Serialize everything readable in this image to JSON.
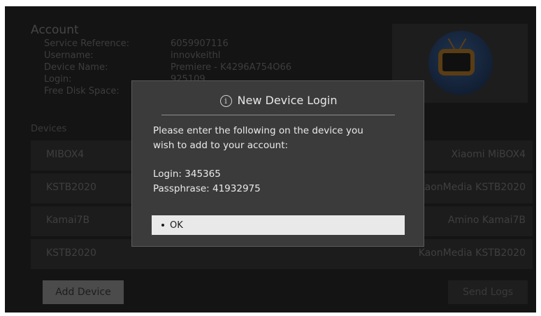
{
  "account": {
    "title": "Account",
    "rows": [
      {
        "label": "Service Reference:",
        "value": "6059907116"
      },
      {
        "label": "Username:",
        "value": "innovkeithl"
      },
      {
        "label": "Device Name:",
        "value": "Premiere - K4296A754O66"
      },
      {
        "label": "Login:",
        "value": "925109"
      },
      {
        "label": "Free Disk Space:",
        "value": ""
      }
    ]
  },
  "devices": {
    "label": "Devices",
    "items": [
      {
        "name": "MIBOX4",
        "model": "Xiaomi MiBOX4"
      },
      {
        "name": "KSTB2020",
        "model": "KaonMedia KSTB2020"
      },
      {
        "name": "Kamai7B",
        "model": "Amino Kamai7B"
      },
      {
        "name": "KSTB2020",
        "model": "KaonMedia KSTB2020"
      }
    ]
  },
  "buttons": {
    "add_device": "Add Device",
    "send_logs": "Send Logs"
  },
  "modal": {
    "icon": "info-icon",
    "title": "New Device Login",
    "line1": "Please enter the following on the device you",
    "line2": "wish to add to your account:",
    "login": "Login: 345365",
    "passphrase": "Passphrase: 41932975",
    "ok_label": "OK"
  },
  "colors": {
    "background": "#141414",
    "modal": "#3b3b3b",
    "tv_accent": "#5a3d14"
  }
}
